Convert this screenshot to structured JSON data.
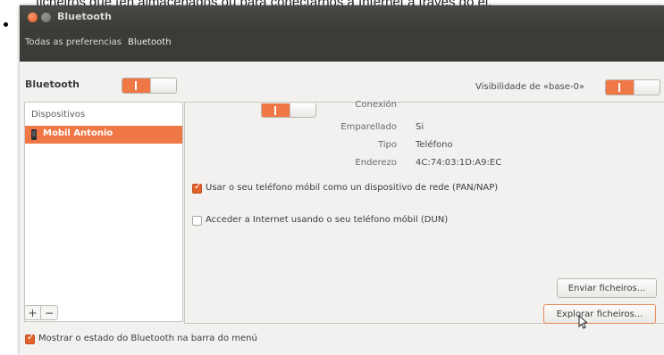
{
  "caption": {
    "text": "ficheiros que ten almacenados ou para conectarnos a Internet a través do el."
  },
  "window": {
    "title": "Bluetooth"
  },
  "toolbar": {
    "all_settings": "Todas as preferencias",
    "current": "Bluetooth"
  },
  "bluetooth": {
    "label": "Bluetooth",
    "enabled": true
  },
  "visibility": {
    "label": "Visibilidade de «base-0»",
    "enabled": true
  },
  "devices": {
    "header": "Dispositivos",
    "items": [
      {
        "name": "Mobil Antonio",
        "icon": "phone-icon",
        "selected": true
      }
    ],
    "add_label": "+",
    "remove_label": "−"
  },
  "details": {
    "connection_label": "Conexión",
    "connection_enabled": true,
    "paired_label": "Emparellado",
    "paired_value": "Si",
    "type_label": "Tipo",
    "type_value": "Teléfono",
    "address_label": "Enderezo",
    "address_value": "4C:74:03:1D:A9:EC",
    "pan_label": "Usar o seu teléfono móbil como un dispositivo de rede (PAN/NAP)",
    "pan_checked": true,
    "dun_label": "Acceder a Internet usando o seu teléfono móbil (DUN)",
    "dun_checked": false,
    "send_files_label": "Enviar ficheiros...",
    "browse_files_label": "Explorar ficheiros..."
  },
  "footer": {
    "show_status_label": "Mostrar o estado do Bluetooth na barra do menú",
    "show_status_checked": true
  },
  "colors": {
    "accent": "#f07746",
    "titlebar": "#3c3b37",
    "window_bg": "#f2f1f0"
  }
}
